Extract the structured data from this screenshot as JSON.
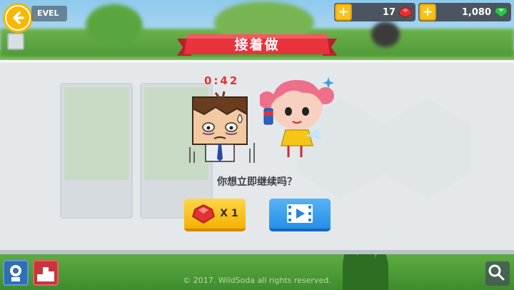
{
  "hud": {
    "level_label": "EVEL",
    "ruby_count": "17",
    "emerald_count": "1,080",
    "plus_symbol": "+"
  },
  "dialog": {
    "title": "接着做",
    "timer": "0:42",
    "question": "你想立即继续吗？",
    "gem_button": {
      "count": "X 1",
      "icon": "ruby-icon"
    },
    "video_button": {
      "icon": "video-play-icon"
    }
  },
  "footer": {
    "copyright": "© 2017. WildSoda all rights reserved."
  },
  "colors": {
    "ribbon_red": "#e8323c",
    "gem_button_yellow": "#f6c21b",
    "video_button_blue": "#2f98ea",
    "timer_red": "#e8312c",
    "panel_gray": "#e4e8ea"
  }
}
